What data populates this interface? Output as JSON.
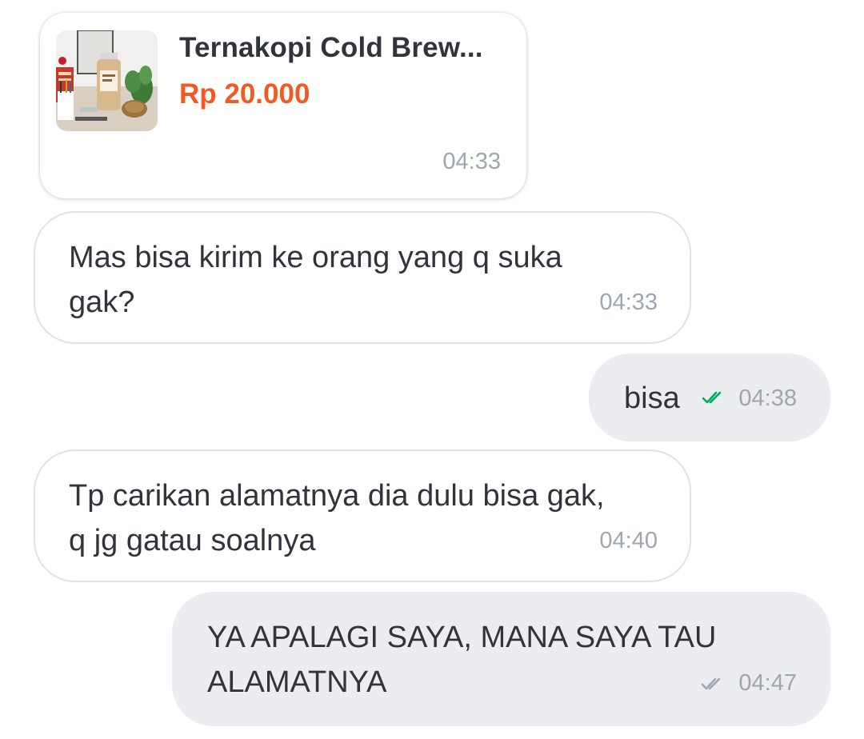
{
  "product_card": {
    "name": "Ternakopi Cold Brew...",
    "price": "Rp 20.000",
    "time": "04:33"
  },
  "messages": [
    {
      "direction": "incoming",
      "lines": [
        "Mas bisa kirim ke orang yang q suka",
        "gak?"
      ],
      "time": "04:33"
    },
    {
      "direction": "outgoing",
      "lines": [
        "bisa"
      ],
      "time": "04:38",
      "status_icon": "double-check-read-icon",
      "status_color": "#00aa5b"
    },
    {
      "direction": "incoming",
      "lines": [
        "Tp carikan alamatnya dia dulu bisa gak,",
        "q jg gatau soalnya"
      ],
      "time": "04:40"
    },
    {
      "direction": "outgoing",
      "lines": [
        "YA APALAGI SAYA, MANA SAYA TAU",
        "ALAMATNYA"
      ],
      "time": "04:47",
      "status_icon": "double-check-delivered-icon",
      "status_color": "#9fa6b0"
    }
  ],
  "colors": {
    "price": "#f15a23",
    "text": "#31353b",
    "timestamp": "#9fa6b0",
    "outgoing_bubble": "#ebedf0",
    "incoming_border": "#e0e2e5",
    "read_check": "#00aa5b"
  }
}
